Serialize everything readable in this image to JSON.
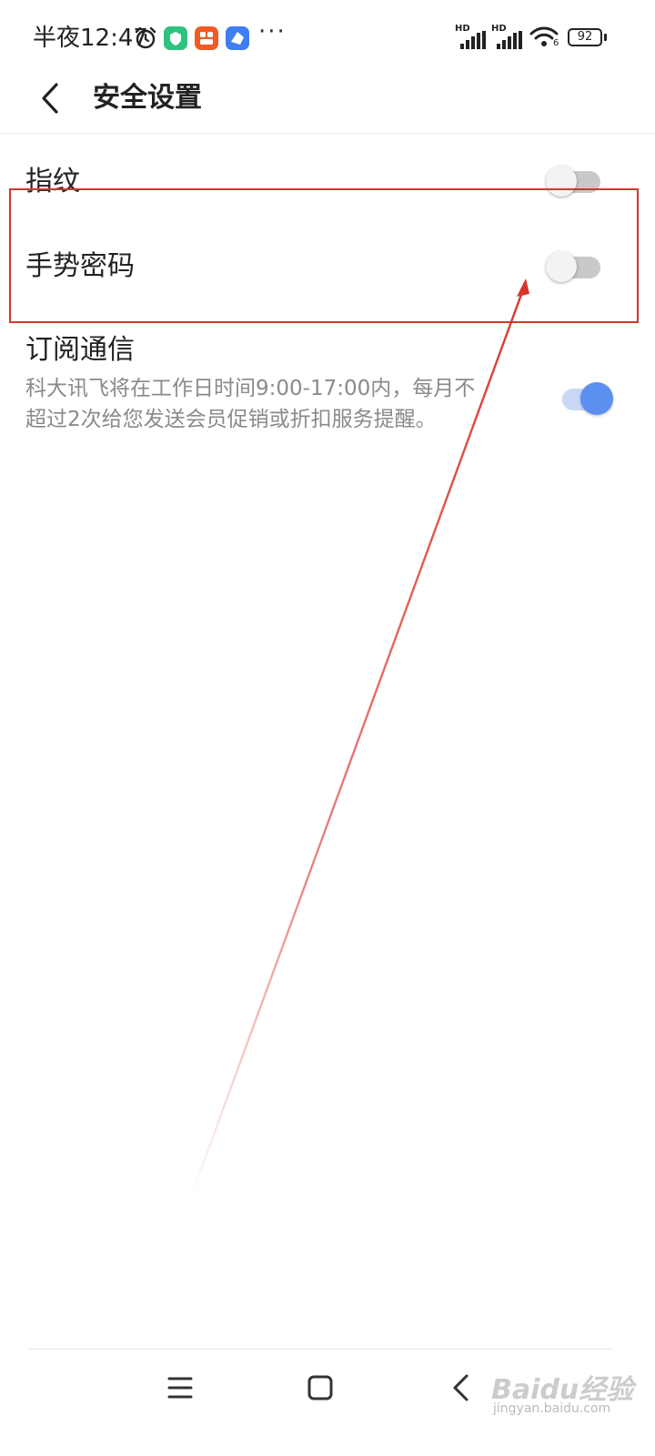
{
  "status_bar": {
    "time": "半夜12:47",
    "more": "···",
    "signal_badge_1": "HD",
    "signal_badge_2": "HD",
    "battery": "92",
    "wifi_sub": "6",
    "icons": [
      "alarm-icon",
      "green-app-icon",
      "orange-app-icon",
      "blue-app-icon",
      "signal-icon",
      "wifi-icon",
      "battery-icon"
    ]
  },
  "header": {
    "title": "安全设置"
  },
  "settings": [
    {
      "label": "指纹",
      "enabled": false
    },
    {
      "label": "手势密码",
      "enabled": false
    },
    {
      "label": "订阅通信",
      "description": "科大讯飞将在工作日时间9:00-17:00内，每月不超过2次给您发送会员促销或折扣服务提醒。",
      "enabled": true
    }
  ],
  "colors": {
    "accent": "#5b8ff0",
    "annotation": "#d9342b"
  },
  "nav_bar": {
    "buttons": [
      "menu-icon",
      "home-icon",
      "back-icon"
    ]
  },
  "watermark": {
    "brand": "Baidu经验",
    "url": "jingyan.baidu.com"
  }
}
